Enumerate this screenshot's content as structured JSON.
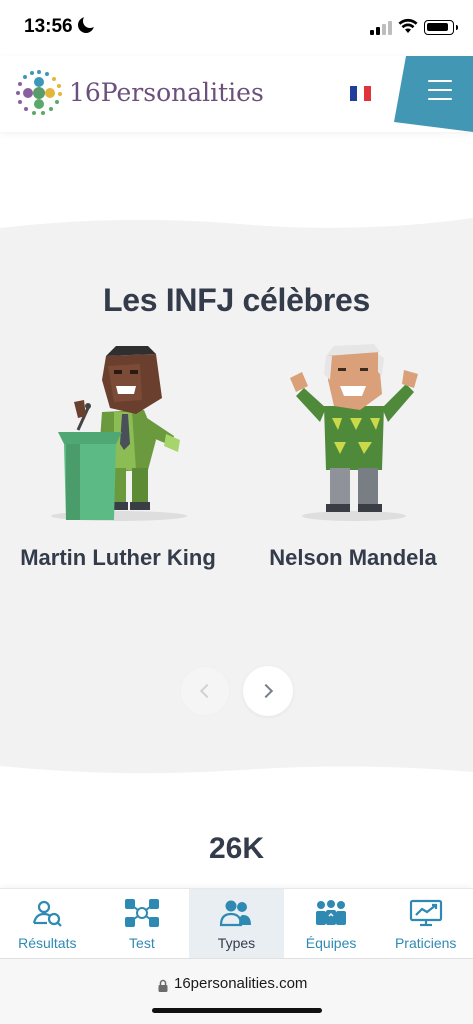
{
  "status_bar": {
    "time": "13:56"
  },
  "header": {
    "brand": "16Personalities",
    "language_flag": "fr-flag-icon",
    "menu_icon": "hamburger-menu-icon"
  },
  "famous": {
    "title": "Les INFJ célèbres",
    "people": [
      {
        "name": "Martin Luther King"
      },
      {
        "name": "Nelson Mandela"
      }
    ],
    "prev_icon": "chevron-left-icon",
    "next_icon": "chevron-right-icon"
  },
  "stats": {
    "number": "26K"
  },
  "bottom_nav": {
    "items": [
      {
        "label": "Résultats",
        "icon": "search-user-icon",
        "active": false
      },
      {
        "label": "Test",
        "icon": "network-icon",
        "active": false
      },
      {
        "label": "Types",
        "icon": "people-icon",
        "active": true
      },
      {
        "label": "Équipes",
        "icon": "team-icon",
        "active": false
      },
      {
        "label": "Praticiens",
        "icon": "presentation-chart-icon",
        "active": false
      }
    ]
  },
  "browser": {
    "url": "16personalities.com"
  },
  "colors": {
    "accent": "#2f8ab3",
    "menu_bg": "#4298b4",
    "text": "#343c4b",
    "section_bg": "#f2f2f2"
  }
}
